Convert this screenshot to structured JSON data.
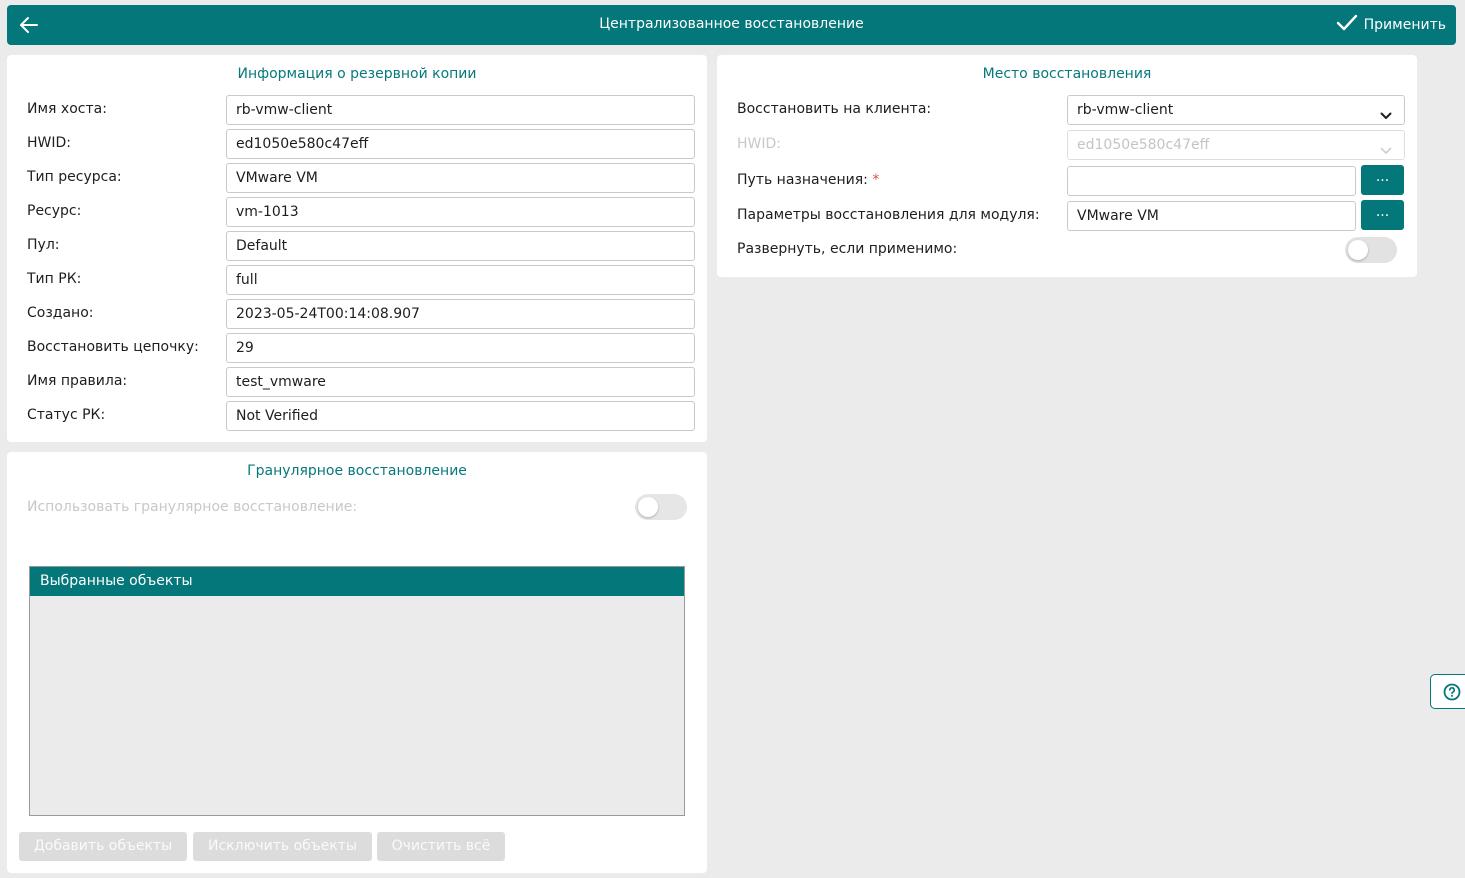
{
  "header": {
    "title": "Централизованное восстановление",
    "apply_label": "Применить"
  },
  "backup_info": {
    "title": "Информация о резервной копии",
    "rows": [
      {
        "label": "Имя хоста:",
        "value": "rb-vmw-client"
      },
      {
        "label": "HWID:",
        "value": "ed1050e580c47eff"
      },
      {
        "label": "Тип ресурса:",
        "value": "VMware VM"
      },
      {
        "label": "Ресурс:",
        "value": "vm-1013"
      },
      {
        "label": "Пул:",
        "value": "Default"
      },
      {
        "label": "Тип РК:",
        "value": "full"
      },
      {
        "label": "Создано:",
        "value": "2023-05-24T00:14:08.907"
      },
      {
        "label": "Восстановить цепочку:",
        "value": "29"
      },
      {
        "label": "Имя правила:",
        "value": "test_vmware"
      },
      {
        "label": "Статус РК:",
        "value": "Not Verified"
      }
    ]
  },
  "restore_location": {
    "title": "Место восстановления",
    "client_label": "Восстановить на клиента:",
    "client_value": "rb-vmw-client",
    "hwid_label": "HWID:",
    "hwid_value": "ed1050e580c47eff",
    "path_label": "Путь назначения:",
    "path_required_mark": "*",
    "path_value": "",
    "module_params_label": "Параметры восстановления для модуля:",
    "module_params_value": "VMware VM",
    "dots_label": "...",
    "deploy_label": "Развернуть, если применимо:",
    "deploy_enabled": false
  },
  "granular": {
    "title": "Гранулярное восстановление",
    "use_label": "Использовать гранулярное восстановление:",
    "use_enabled": false,
    "selected_header": "Выбранные объекты",
    "add_button": "Добавить объекты",
    "exclude_button": "Исключить объекты",
    "clear_button": "Очистить всё"
  },
  "colors": {
    "accent": "#03777a",
    "background": "#ebebeb"
  }
}
